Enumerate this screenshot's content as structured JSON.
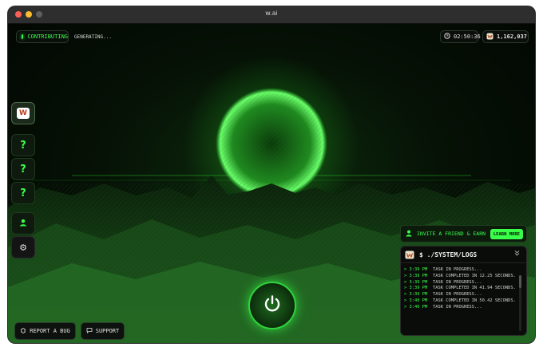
{
  "window": {
    "title": "w.ai"
  },
  "header": {
    "status_label": "CONTRIBUTING",
    "generating_label": "GENERATING...",
    "timer": "02:50:36",
    "points": "1,162,037"
  },
  "sidebar": {
    "items": [
      {
        "icon": "wai-logo-icon",
        "label": "W"
      },
      {
        "icon": "help-icon",
        "label": "?"
      },
      {
        "icon": "help-icon",
        "label": "?"
      },
      {
        "icon": "help-icon",
        "label": "?"
      },
      {
        "icon": "user-icon",
        "label": ""
      },
      {
        "icon": "gear-icon",
        "label": "⚙"
      }
    ]
  },
  "footer": {
    "report_label": "REPORT A BUG",
    "support_label": "SUPPORT"
  },
  "invite": {
    "label": "INVITE A FRIEND & EARN",
    "button_label": "LEARN MORE"
  },
  "logs": {
    "title": "$ ./SYSTEM/LOGS",
    "entries": [
      {
        "time": "> 3:39 PM",
        "text": "TASK IN PROGRESS..."
      },
      {
        "time": "> 3:39 PM",
        "text": "TASK COMPLETED IN 12.25 SECONDS."
      },
      {
        "time": "> 3:39 PM",
        "text": "TASK IN PROGRESS..."
      },
      {
        "time": "> 3:39 PM",
        "text": "TASK COMPLETED IN 41.94 SECONDS."
      },
      {
        "time": "> 3:39 PM",
        "text": "TASK IN PROGRESS..."
      },
      {
        "time": "> 3:40 PM",
        "text": "TASK COMPLETED IN 50.42 SECONDS."
      },
      {
        "time": "> 3:40 PM",
        "text": "TASK IN PROGRESS..."
      }
    ]
  },
  "colors": {
    "accent": "#39ff4a",
    "background": "#050805"
  }
}
